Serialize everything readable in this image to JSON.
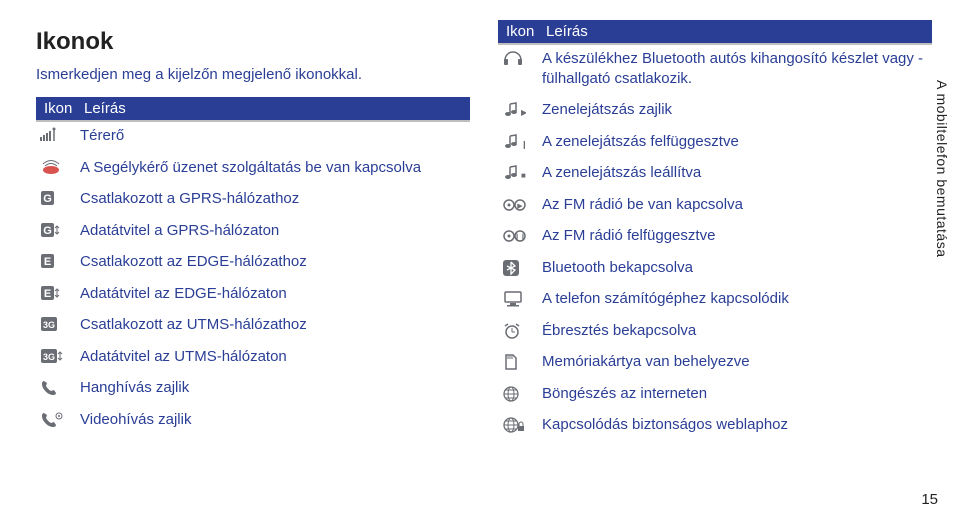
{
  "title": "Ikonok",
  "intro": "Ismerkedjen meg a kijelzőn megjelenő ikonokkal.",
  "headers": {
    "icon": "Ikon",
    "desc": "Leírás"
  },
  "left": [
    {
      "icon": "signal",
      "text": "Térerő"
    },
    {
      "icon": "sos",
      "text": "A Segélykérő üzenet szolgáltatás be van kapcsolva"
    },
    {
      "icon": "G",
      "text": "Csatlakozott a GPRS-hálózathoz"
    },
    {
      "icon": "Gtx",
      "text": "Adatátvitel a GPRS-hálózaton"
    },
    {
      "icon": "E",
      "text": "Csatlakozott az EDGE-hálózathoz"
    },
    {
      "icon": "Etx",
      "text": "Adatátvitel az EDGE-hálózaton"
    },
    {
      "icon": "3G",
      "text": "Csatlakozott az UTMS-hálózathoz"
    },
    {
      "icon": "3Gtx",
      "text": "Adatátvitel az UTMS-hálózaton"
    },
    {
      "icon": "call",
      "text": "Hanghívás zajlik"
    },
    {
      "icon": "vcall",
      "text": "Videohívás zajlik"
    }
  ],
  "right": [
    {
      "icon": "bthead",
      "text": "A készülékhez Bluetooth autós kihangosító készlet vagy -fülhallgató csatlakozik."
    },
    {
      "icon": "music",
      "text": "Zenelejátszás zajlik"
    },
    {
      "icon": "mpause",
      "text": "A zenelejátszás felfüggesztve"
    },
    {
      "icon": "mstop",
      "text": "A zenelejátszás leállítva"
    },
    {
      "icon": "fm",
      "text": "Az FM rádió be van kapcsolva"
    },
    {
      "icon": "fmp",
      "text": "Az FM rádió felfüggesztve"
    },
    {
      "icon": "bt",
      "text": "Bluetooth bekapcsolva"
    },
    {
      "icon": "pc",
      "text": "A telefon számítógéphez kapcsolódik"
    },
    {
      "icon": "alarm",
      "text": "Ébresztés bekapcsolva"
    },
    {
      "icon": "sd",
      "text": "Memóriakártya van behelyezve"
    },
    {
      "icon": "globe",
      "text": "Böngészés az interneten"
    },
    {
      "icon": "globes",
      "text": "Kapcsolódás biztonságos weblaphoz"
    }
  ],
  "side": "A mobiltelefon bemutatása",
  "page": "15"
}
